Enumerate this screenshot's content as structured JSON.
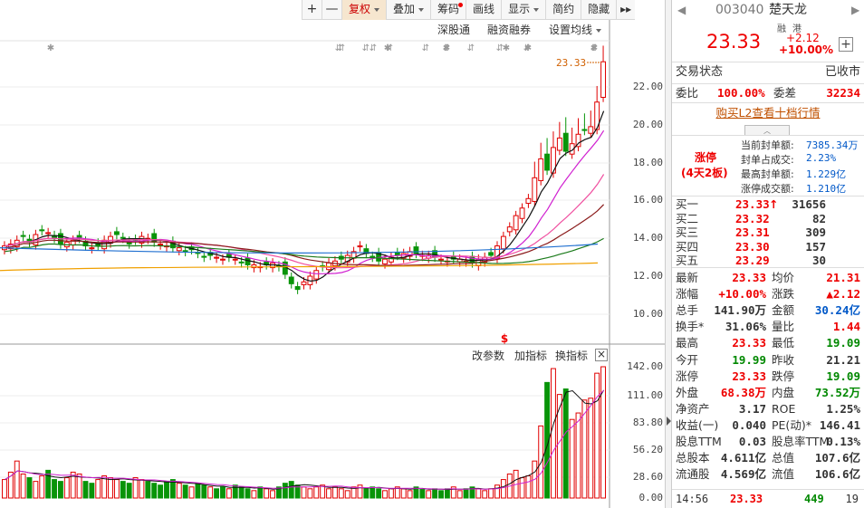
{
  "toolbar": {
    "items": [
      {
        "id": "plus",
        "label": "+"
      },
      {
        "id": "minus",
        "label": "—"
      },
      {
        "id": "fuquan",
        "label": "复权",
        "active": true,
        "caret": true
      },
      {
        "id": "diejia",
        "label": "叠加",
        "caret": true
      },
      {
        "id": "chouma",
        "label": "筹码",
        "dot": true
      },
      {
        "id": "huaxian",
        "label": "画线"
      },
      {
        "id": "xianshi",
        "label": "显示",
        "caret": true
      },
      {
        "id": "jianyue",
        "label": "简约"
      },
      {
        "id": "yincang",
        "label": "隐藏"
      },
      {
        "id": "collapse",
        "label": "▸▸"
      }
    ]
  },
  "chart_links": {
    "sgt": "深股通",
    "rzrq": "融资融券",
    "ma": "设置均线"
  },
  "price_axis": [
    "22.00",
    "20.00",
    "18.00",
    "16.00",
    "14.00",
    "12.00",
    "10.00"
  ],
  "last_marker": "23.33",
  "vol_toolbar": {
    "params": "改参数",
    "add": "加指标",
    "swap": "换指标",
    "close": "×"
  },
  "vol_axis": [
    "142.00",
    "111.00",
    "83.80",
    "56.20",
    "28.60",
    "0.00"
  ],
  "stock": {
    "code": "003040",
    "name": "楚天龙",
    "tag1": "融",
    "tag2": "港",
    "price": "23.33",
    "change": "+2.12",
    "pct": "+10.00%",
    "add": "+"
  },
  "trade_status": {
    "label": "交易状态",
    "value": "已收市"
  },
  "weibi": {
    "l1": "委比",
    "v1": "100.00%",
    "l2": "委差",
    "v2": "32234"
  },
  "buy_l2": "购买L2查看十档行情",
  "limit_up": {
    "title": "涨停",
    "sub": "(4天2板)",
    "rows": [
      {
        "k": "当前封单额:",
        "v": "7385.34万"
      },
      {
        "k": "封单占成交:",
        "v": "2.23%"
      },
      {
        "k": "最高封单额:",
        "v": "1.229亿"
      },
      {
        "k": "涨停成交额:",
        "v": "1.210亿"
      }
    ]
  },
  "bids": [
    {
      "label": "买一",
      "price": "23.33",
      "arrow": "↑",
      "vol": "31656"
    },
    {
      "label": "买二",
      "price": "23.32",
      "arrow": "",
      "vol": "82"
    },
    {
      "label": "买三",
      "price": "23.31",
      "arrow": "",
      "vol": "309"
    },
    {
      "label": "买四",
      "price": "23.30",
      "arrow": "",
      "vol": "157"
    },
    {
      "label": "买五",
      "price": "23.29",
      "arrow": "",
      "vol": "30"
    }
  ],
  "quote": [
    {
      "k1": "最新",
      "v1": "23.33",
      "c1": "red",
      "k2": "均价",
      "v2": "21.31",
      "c2": "red"
    },
    {
      "k1": "涨幅",
      "v1": "+10.00%",
      "c1": "red",
      "k2": "涨跌",
      "v2": "▲2.12",
      "c2": "red"
    },
    {
      "k1": "总手",
      "v1": "141.90万",
      "c1": "",
      "k2": "金额",
      "v2": "30.24亿",
      "c2": "blue"
    },
    {
      "k1": "换手*",
      "v1": "31.06%",
      "c1": "",
      "k2": "量比",
      "v2": "1.44",
      "c2": "red"
    },
    {
      "k1": "最高",
      "v1": "23.33",
      "c1": "red",
      "k2": "最低",
      "v2": "19.09",
      "c2": "green"
    },
    {
      "k1": "今开",
      "v1": "19.99",
      "c1": "green",
      "k2": "昨收",
      "v2": "21.21",
      "c2": ""
    },
    {
      "k1": "涨停",
      "v1": "23.33",
      "c1": "red",
      "k2": "跌停",
      "v2": "19.09",
      "c2": "green"
    },
    {
      "k1": "外盘",
      "v1": "68.38万",
      "c1": "red",
      "k2": "内盘",
      "v2": "73.52万",
      "c2": "green"
    },
    {
      "k1": "净资产",
      "v1": "3.17",
      "c1": "",
      "k2": "ROE",
      "v2": "1.25%",
      "c2": ""
    },
    {
      "k1": "收益(一)",
      "v1": "0.040",
      "c1": "",
      "k2": "PE(动)*",
      "v2": "146.41",
      "c2": ""
    },
    {
      "k1": "股息TTM",
      "v1": "0.03",
      "c1": "",
      "k2": "股息率TTM",
      "v2": "0.13%",
      "c2": ""
    },
    {
      "k1": "总股本",
      "v1": "4.611亿",
      "c1": "",
      "k2": "总值",
      "v2": "107.6亿",
      "c2": ""
    },
    {
      "k1": "流通股",
      "v1": "4.569亿",
      "c1": "",
      "k2": "流值",
      "v2": "106.6亿",
      "c2": ""
    }
  ],
  "tick": {
    "time": "14:56",
    "price": "23.33",
    "vol": "449",
    "count": "19"
  },
  "colors": {
    "up": "#e00000",
    "down": "#089408",
    "ma5": "#111111",
    "ma10": "#d020d0",
    "ma20": "#c09000",
    "ma60": "#1a7a1a",
    "ma120": "#1f6fd0",
    "ma250": "#f0a000"
  }
}
